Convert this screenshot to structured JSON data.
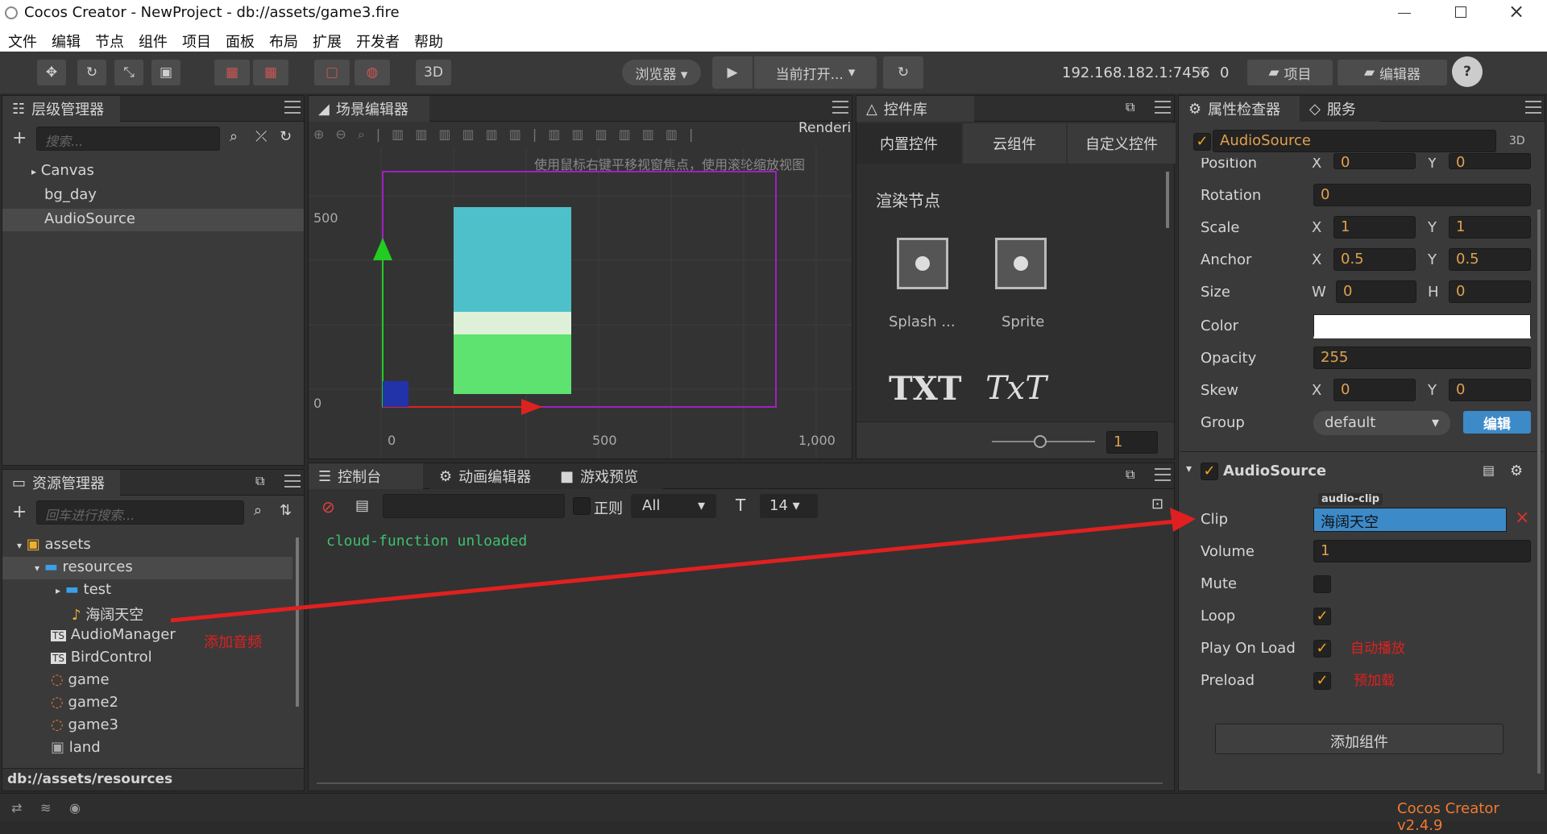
{
  "window": {
    "title": "Cocos Creator - NewProject - db://assets/game3.fire",
    "min_icon": "minimize-icon",
    "max_icon": "restore-icon",
    "close_icon": "close-icon"
  },
  "menu": [
    "文件",
    "编辑",
    "节点",
    "组件",
    "项目",
    "面板",
    "布局",
    "扩展",
    "开发者",
    "帮助"
  ],
  "toolbar": {
    "btn_3d": "3D",
    "browser": "浏览器 ▾",
    "current_open": "当前打开...",
    "ip": "192.168.182.1:7456",
    "device_count": "0",
    "project": "项目",
    "editor": "编辑器",
    "help": "?"
  },
  "hierarchy": {
    "title": "层级管理器",
    "search_placeholder": "搜索...",
    "items": [
      "Canvas",
      "bg_day",
      "AudioSource"
    ]
  },
  "scene": {
    "title": "场景编辑器",
    "render_label": "Renderi",
    "hint": "使用鼠标右键平移视窗焦点，使用滚轮缩放视图",
    "y500": "500",
    "y0": "0",
    "x0": "0",
    "x500": "500",
    "x1000": "1,000"
  },
  "widgets": {
    "title": "控件库",
    "tabs": [
      "内置控件",
      "云组件",
      "自定义控件"
    ],
    "section": "渲染节点",
    "items": [
      "Splash ...",
      "Sprite"
    ],
    "txt1": "TXT",
    "txt2": "TxT",
    "zoom_value": "1"
  },
  "assets": {
    "title": "资源管理器",
    "search_placeholder": "回车进行搜索...",
    "tree": [
      "assets",
      "resources",
      "test",
      "海阔天空",
      "AudioManager",
      "BirdControl",
      "game",
      "game2",
      "game3",
      "land"
    ],
    "annotation": "添加音频",
    "path": "db://assets/resources"
  },
  "console": {
    "tabs": [
      "控制台",
      "动画编辑器",
      "游戏预览"
    ],
    "regex": "正则",
    "filter": "All",
    "font_size": "14",
    "log": "cloud-function unloaded"
  },
  "inspector": {
    "tabs": [
      "属性检查器",
      "服务"
    ],
    "node_name": "AudioSource",
    "badge_3d": "3D",
    "position_label": "Position",
    "position": {
      "x": "0",
      "y": "0"
    },
    "rotation_label": "Rotation",
    "rotation": "0",
    "scale_label": "Scale",
    "scale": {
      "x": "1",
      "y": "1"
    },
    "anchor_label": "Anchor",
    "anchor": {
      "x": "0.5",
      "y": "0.5"
    },
    "size_label": "Size",
    "size": {
      "w": "0",
      "h": "0"
    },
    "color_label": "Color",
    "color_value": "#ffffff",
    "opacity_label": "Opacity",
    "opacity": "255",
    "skew_label": "Skew",
    "skew": {
      "x": "0",
      "y": "0"
    },
    "group_label": "Group",
    "group": "default",
    "group_edit": "编辑",
    "axis": {
      "x": "X",
      "y": "Y",
      "w": "W",
      "h": "H"
    },
    "component": "AudioSource",
    "clip_tag": "audio-clip",
    "clip_label": "Clip",
    "clip_value": "海阔天空",
    "volume_label": "Volume",
    "volume": "1",
    "mute_label": "Mute",
    "loop_label": "Loop",
    "playonload_label": "Play On Load",
    "preload_label": "Preload",
    "note_autoplay": "自动播放",
    "note_preload": "预加载",
    "add_component": "添加组件"
  },
  "status": {
    "version": "Cocos Creator v2.4.9"
  },
  "colors": {
    "accent": "#f5a623",
    "clip_bg": "#3d8ac9",
    "annotation_red": "#e02020"
  }
}
